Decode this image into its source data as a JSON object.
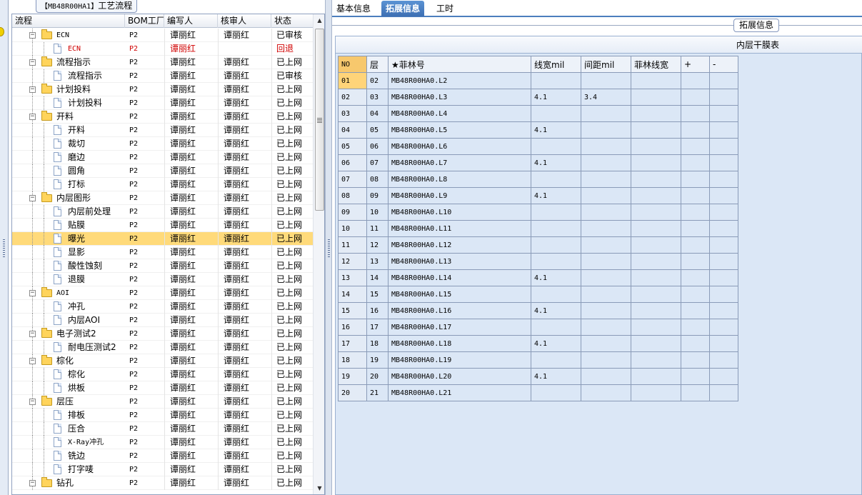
{
  "left_panel": {
    "caption_code": "【MB48R00HA1】",
    "caption_text": "工艺流程",
    "columns": [
      "流程",
      "BOM工厂",
      "编写人",
      "核审人",
      "状态"
    ],
    "rows": [
      {
        "name": "ECN",
        "level": 0,
        "bom": "P2",
        "author": "谭丽红",
        "reviewer": "谭丽红",
        "status": "已审核"
      },
      {
        "name": "ECN",
        "level": 1,
        "bom": "P2",
        "author": "谭丽红",
        "reviewer": "",
        "status": "回退",
        "red": true
      },
      {
        "name": "流程指示",
        "level": 0,
        "bom": "P2",
        "author": "谭丽红",
        "reviewer": "谭丽红",
        "status": "已上网"
      },
      {
        "name": "流程指示",
        "level": 1,
        "bom": "P2",
        "author": "谭丽红",
        "reviewer": "谭丽红",
        "status": "已审核"
      },
      {
        "name": "计划投料",
        "level": 0,
        "bom": "P2",
        "author": "谭丽红",
        "reviewer": "谭丽红",
        "status": "已上网"
      },
      {
        "name": "计划投料",
        "level": 1,
        "bom": "P2",
        "author": "谭丽红",
        "reviewer": "谭丽红",
        "status": "已上网"
      },
      {
        "name": "开料",
        "level": 0,
        "bom": "P2",
        "author": "谭丽红",
        "reviewer": "谭丽红",
        "status": "已上网"
      },
      {
        "name": "开料",
        "level": 1,
        "bom": "P2",
        "author": "谭丽红",
        "reviewer": "谭丽红",
        "status": "已上网"
      },
      {
        "name": "裁切",
        "level": 1,
        "bom": "P2",
        "author": "谭丽红",
        "reviewer": "谭丽红",
        "status": "已上网"
      },
      {
        "name": "磨边",
        "level": 1,
        "bom": "P2",
        "author": "谭丽红",
        "reviewer": "谭丽红",
        "status": "已上网"
      },
      {
        "name": "圆角",
        "level": 1,
        "bom": "P2",
        "author": "谭丽红",
        "reviewer": "谭丽红",
        "status": "已上网"
      },
      {
        "name": "打标",
        "level": 1,
        "bom": "P2",
        "author": "谭丽红",
        "reviewer": "谭丽红",
        "status": "已上网"
      },
      {
        "name": "内层图形",
        "level": 0,
        "bom": "P2",
        "author": "谭丽红",
        "reviewer": "谭丽红",
        "status": "已上网"
      },
      {
        "name": "内层前处理",
        "level": 1,
        "bom": "P2",
        "author": "谭丽红",
        "reviewer": "谭丽红",
        "status": "已上网"
      },
      {
        "name": "贴膜",
        "level": 1,
        "bom": "P2",
        "author": "谭丽红",
        "reviewer": "谭丽红",
        "status": "已上网"
      },
      {
        "name": "曝光",
        "level": 1,
        "bom": "P2",
        "author": "谭丽红",
        "reviewer": "谭丽红",
        "status": "已上网",
        "selected": true
      },
      {
        "name": "显影",
        "level": 1,
        "bom": "P2",
        "author": "谭丽红",
        "reviewer": "谭丽红",
        "status": "已上网"
      },
      {
        "name": "酸性蚀刻",
        "level": 1,
        "bom": "P2",
        "author": "谭丽红",
        "reviewer": "谭丽红",
        "status": "已上网"
      },
      {
        "name": "退膜",
        "level": 1,
        "bom": "P2",
        "author": "谭丽红",
        "reviewer": "谭丽红",
        "status": "已上网"
      },
      {
        "name": "AOI",
        "level": 0,
        "bom": "P2",
        "author": "谭丽红",
        "reviewer": "谭丽红",
        "status": "已上网"
      },
      {
        "name": "冲孔",
        "level": 1,
        "bom": "P2",
        "author": "谭丽红",
        "reviewer": "谭丽红",
        "status": "已上网"
      },
      {
        "name": "内层AOI",
        "level": 1,
        "bom": "P2",
        "author": "谭丽红",
        "reviewer": "谭丽红",
        "status": "已上网"
      },
      {
        "name": "电子测试2",
        "level": 0,
        "bom": "P2",
        "author": "谭丽红",
        "reviewer": "谭丽红",
        "status": "已上网"
      },
      {
        "name": "耐电压测试2",
        "level": 1,
        "bom": "P2",
        "author": "谭丽红",
        "reviewer": "谭丽红",
        "status": "已上网"
      },
      {
        "name": "棕化",
        "level": 0,
        "bom": "P2",
        "author": "谭丽红",
        "reviewer": "谭丽红",
        "status": "已上网"
      },
      {
        "name": "棕化",
        "level": 1,
        "bom": "P2",
        "author": "谭丽红",
        "reviewer": "谭丽红",
        "status": "已上网"
      },
      {
        "name": "烘板",
        "level": 1,
        "bom": "P2",
        "author": "谭丽红",
        "reviewer": "谭丽红",
        "status": "已上网"
      },
      {
        "name": "层压",
        "level": 0,
        "bom": "P2",
        "author": "谭丽红",
        "reviewer": "谭丽红",
        "status": "已上网"
      },
      {
        "name": "排板",
        "level": 1,
        "bom": "P2",
        "author": "谭丽红",
        "reviewer": "谭丽红",
        "status": "已上网"
      },
      {
        "name": "压合",
        "level": 1,
        "bom": "P2",
        "author": "谭丽红",
        "reviewer": "谭丽红",
        "status": "已上网"
      },
      {
        "name": "X-Ray冲孔",
        "level": 1,
        "bom": "P2",
        "author": "谭丽红",
        "reviewer": "谭丽红",
        "status": "已上网"
      },
      {
        "name": "铣边",
        "level": 1,
        "bom": "P2",
        "author": "谭丽红",
        "reviewer": "谭丽红",
        "status": "已上网"
      },
      {
        "name": "打字唛",
        "level": 1,
        "bom": "P2",
        "author": "谭丽红",
        "reviewer": "谭丽红",
        "status": "已上网"
      },
      {
        "name": "钻孔",
        "level": 0,
        "bom": "P2",
        "author": "谭丽红",
        "reviewer": "谭丽红",
        "status": "已上网"
      }
    ]
  },
  "tabs": [
    {
      "label": "基本信息",
      "active": false
    },
    {
      "label": "拓展信息",
      "active": true
    },
    {
      "label": "工时",
      "active": false
    }
  ],
  "right_panel": {
    "group_caption": "拓展信息",
    "grid_title": "内层干膜表",
    "columns": [
      "NO",
      "层",
      "★菲林号",
      "线宽mil",
      "间距mil",
      "菲林线宽",
      "+",
      "-"
    ],
    "rows": [
      {
        "no": "01",
        "layer": "02",
        "film": "MB48R00HA0.L2",
        "width": "",
        "spacing": ""
      },
      {
        "no": "02",
        "layer": "03",
        "film": "MB48R00HA0.L3",
        "width": "4.1",
        "spacing": "3.4"
      },
      {
        "no": "03",
        "layer": "04",
        "film": "MB48R00HA0.L4",
        "width": "",
        "spacing": ""
      },
      {
        "no": "04",
        "layer": "05",
        "film": "MB48R00HA0.L5",
        "width": "4.1",
        "spacing": ""
      },
      {
        "no": "05",
        "layer": "06",
        "film": "MB48R00HA0.L6",
        "width": "",
        "spacing": ""
      },
      {
        "no": "06",
        "layer": "07",
        "film": "MB48R00HA0.L7",
        "width": "4.1",
        "spacing": ""
      },
      {
        "no": "07",
        "layer": "08",
        "film": "MB48R00HA0.L8",
        "width": "",
        "spacing": ""
      },
      {
        "no": "08",
        "layer": "09",
        "film": "MB48R00HA0.L9",
        "width": "4.1",
        "spacing": ""
      },
      {
        "no": "09",
        "layer": "10",
        "film": "MB48R00HA0.L10",
        "width": "",
        "spacing": ""
      },
      {
        "no": "10",
        "layer": "11",
        "film": "MB48R00HA0.L11",
        "width": "",
        "spacing": ""
      },
      {
        "no": "11",
        "layer": "12",
        "film": "MB48R00HA0.L12",
        "width": "",
        "spacing": ""
      },
      {
        "no": "12",
        "layer": "13",
        "film": "MB48R00HA0.L13",
        "width": "",
        "spacing": ""
      },
      {
        "no": "13",
        "layer": "14",
        "film": "MB48R00HA0.L14",
        "width": "4.1",
        "spacing": ""
      },
      {
        "no": "14",
        "layer": "15",
        "film": "MB48R00HA0.L15",
        "width": "",
        "spacing": ""
      },
      {
        "no": "15",
        "layer": "16",
        "film": "MB48R00HA0.L16",
        "width": "4.1",
        "spacing": ""
      },
      {
        "no": "16",
        "layer": "17",
        "film": "MB48R00HA0.L17",
        "width": "",
        "spacing": ""
      },
      {
        "no": "17",
        "layer": "18",
        "film": "MB48R00HA0.L18",
        "width": "4.1",
        "spacing": ""
      },
      {
        "no": "18",
        "layer": "19",
        "film": "MB48R00HA0.L19",
        "width": "",
        "spacing": ""
      },
      {
        "no": "19",
        "layer": "20",
        "film": "MB48R00HA0.L20",
        "width": "4.1",
        "spacing": ""
      },
      {
        "no": "20",
        "layer": "21",
        "film": "MB48R00HA0.L21",
        "width": "",
        "spacing": ""
      }
    ]
  },
  "icons": {
    "tree_folder": "folder-icon",
    "tree_item": "document-icon",
    "scroll_up": "arrow-up-icon",
    "scroll_down": "arrow-down-icon"
  },
  "colors": {
    "selected_row": "#ffda7a",
    "active_tab": "#3d6fb3",
    "grid_background": "#dbe7f6",
    "rejected_text": "#d00000"
  }
}
